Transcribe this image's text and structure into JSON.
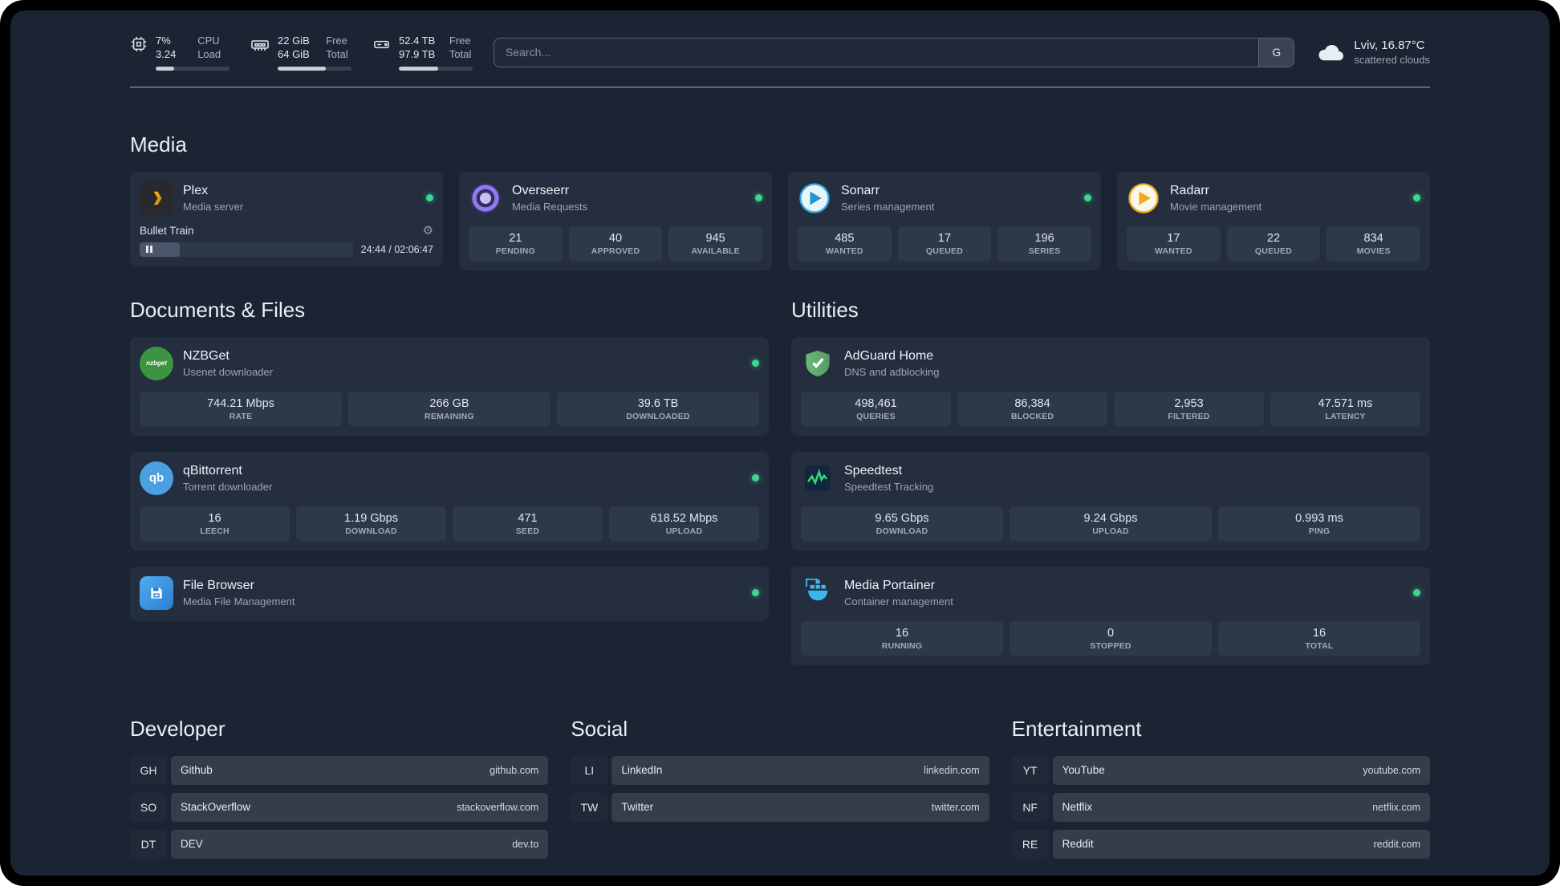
{
  "topbar": {
    "resources": [
      {
        "v1": "7%",
        "v2": "3.24",
        "l1": "CPU",
        "l2": "Load",
        "percent": 25
      },
      {
        "v1": "22 GiB",
        "v2": "64 GiB",
        "l1": "Free",
        "l2": "Total",
        "percent": 65
      },
      {
        "v1": "52.4 TB",
        "v2": "97.9 TB",
        "l1": "Free",
        "l2": "Total",
        "percent": 53
      }
    ],
    "search": {
      "placeholder": "Search...",
      "provider_label": "G"
    },
    "weather": {
      "location": "Lviv, 16.87°C",
      "condition": "scattered clouds"
    }
  },
  "sections": {
    "media": {
      "title": "Media"
    },
    "documents": {
      "title": "Documents & Files"
    },
    "utilities": {
      "title": "Utilities"
    },
    "developer": {
      "title": "Developer"
    },
    "social": {
      "title": "Social"
    },
    "entertainment": {
      "title": "Entertainment"
    }
  },
  "services": {
    "plex": {
      "name": "Plex",
      "desc": "Media server",
      "player": {
        "track": "Bullet Train",
        "time": "24:44 / 02:06:47",
        "progress_percent": 19
      }
    },
    "overseerr": {
      "name": "Overseerr",
      "desc": "Media Requests",
      "stats": [
        {
          "value": "21",
          "label": "PENDING"
        },
        {
          "value": "40",
          "label": "APPROVED"
        },
        {
          "value": "945",
          "label": "AVAILABLE"
        }
      ]
    },
    "sonarr": {
      "name": "Sonarr",
      "desc": "Series management",
      "stats": [
        {
          "value": "485",
          "label": "WANTED"
        },
        {
          "value": "17",
          "label": "QUEUED"
        },
        {
          "value": "196",
          "label": "SERIES"
        }
      ]
    },
    "radarr": {
      "name": "Radarr",
      "desc": "Movie management",
      "stats": [
        {
          "value": "17",
          "label": "WANTED"
        },
        {
          "value": "22",
          "label": "QUEUED"
        },
        {
          "value": "834",
          "label": "MOVIES"
        }
      ]
    },
    "nzbget": {
      "name": "NZBGet",
      "desc": "Usenet downloader",
      "icon_text": "nzbget",
      "stats": [
        {
          "value": "744.21 Mbps",
          "label": "RATE"
        },
        {
          "value": "266 GB",
          "label": "REMAINING"
        },
        {
          "value": "39.6 TB",
          "label": "DOWNLOADED"
        }
      ]
    },
    "qbittorrent": {
      "name": "qBittorrent",
      "desc": "Torrent downloader",
      "icon_text": "qb",
      "stats": [
        {
          "value": "16",
          "label": "LEECH"
        },
        {
          "value": "1.19 Gbps",
          "label": "DOWNLOAD"
        },
        {
          "value": "471",
          "label": "SEED"
        },
        {
          "value": "618.52 Mbps",
          "label": "UPLOAD"
        }
      ]
    },
    "filebrowser": {
      "name": "File Browser",
      "desc": "Media File Management"
    },
    "adguard": {
      "name": "AdGuard Home",
      "desc": "DNS and adblocking",
      "stats": [
        {
          "value": "498,461",
          "label": "QUERIES"
        },
        {
          "value": "86,384",
          "label": "BLOCKED"
        },
        {
          "value": "2,953",
          "label": "FILTERED"
        },
        {
          "value": "47.571 ms",
          "label": "LATENCY"
        }
      ]
    },
    "speedtest": {
      "name": "Speedtest",
      "desc": "Speedtest Tracking",
      "stats": [
        {
          "value": "9.65 Gbps",
          "label": "DOWNLOAD"
        },
        {
          "value": "9.24 Gbps",
          "label": "UPLOAD"
        },
        {
          "value": "0.993 ms",
          "label": "PING"
        }
      ]
    },
    "portainer": {
      "name": "Media Portainer",
      "desc": "Container management",
      "stats": [
        {
          "value": "16",
          "label": "RUNNING"
        },
        {
          "value": "0",
          "label": "STOPPED"
        },
        {
          "value": "16",
          "label": "TOTAL"
        }
      ]
    }
  },
  "bookmarks": {
    "developer": [
      {
        "abbr": "GH",
        "name": "Github",
        "domain": "github.com"
      },
      {
        "abbr": "SO",
        "name": "StackOverflow",
        "domain": "stackoverflow.com"
      },
      {
        "abbr": "DT",
        "name": "DEV",
        "domain": "dev.to"
      }
    ],
    "social": [
      {
        "abbr": "LI",
        "name": "LinkedIn",
        "domain": "linkedin.com"
      },
      {
        "abbr": "TW",
        "name": "Twitter",
        "domain": "twitter.com"
      }
    ],
    "entertainment": [
      {
        "abbr": "YT",
        "name": "YouTube",
        "domain": "youtube.com"
      },
      {
        "abbr": "NF",
        "name": "Netflix",
        "domain": "netflix.com"
      },
      {
        "abbr": "RE",
        "name": "Reddit",
        "domain": "reddit.com"
      }
    ]
  }
}
